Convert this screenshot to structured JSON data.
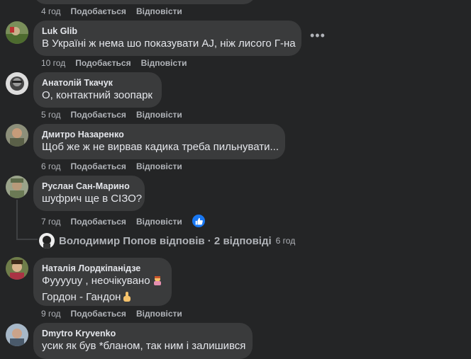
{
  "comments": [
    {
      "meta": {
        "time": "4 год",
        "like": "Подобається",
        "reply": "Відповісти"
      }
    },
    {
      "author": "Luk Glib",
      "text": "В Україні ж нема шо показувати AJ, ніж лисого Г-на",
      "meta": {
        "time": "10 год",
        "like": "Подобається",
        "reply": "Відповісти"
      }
    },
    {
      "author": "Анатолій Ткачук",
      "text": "О, контактний зоопарк",
      "meta": {
        "time": "5 год",
        "like": "Подобається",
        "reply": "Відповісти"
      }
    },
    {
      "author": "Дмитро Назаренко",
      "text": "Щоб же ж не вирвав кадика треба пильнувати...",
      "meta": {
        "time": "6 год",
        "like": "Подобається",
        "reply": "Відповісти"
      }
    },
    {
      "author": "Руслан Сан-Марино",
      "text": "шуфрич ще в СІЗО?",
      "meta": {
        "time": "7 год",
        "like": "Подобається",
        "reply": "Відповісти"
      }
    },
    {
      "author": "Наталія Лордкіпанідзе",
      "text_line1": "Фууууuу , неочікувано",
      "text_line2": "Гордон - Гандон",
      "meta": {
        "time": "9 год",
        "like": "Подобається",
        "reply": "Відповісти"
      }
    },
    {
      "author": "Dmytro Kryvenko",
      "text": "усик як був *бланом, так ним і залишився"
    }
  ],
  "reply_summary": {
    "text": "Володимир Попов відповів · 2 відповіді",
    "time": "6 год"
  },
  "more_icon": "more-horizontal-icon",
  "reaction_icon": "like-reaction-icon",
  "colors": {
    "background": "#242526",
    "bubble": "#3a3b3c",
    "text": "#e4e6eb",
    "secondary": "#b0b3b8",
    "like_blue": "#1877f2"
  }
}
